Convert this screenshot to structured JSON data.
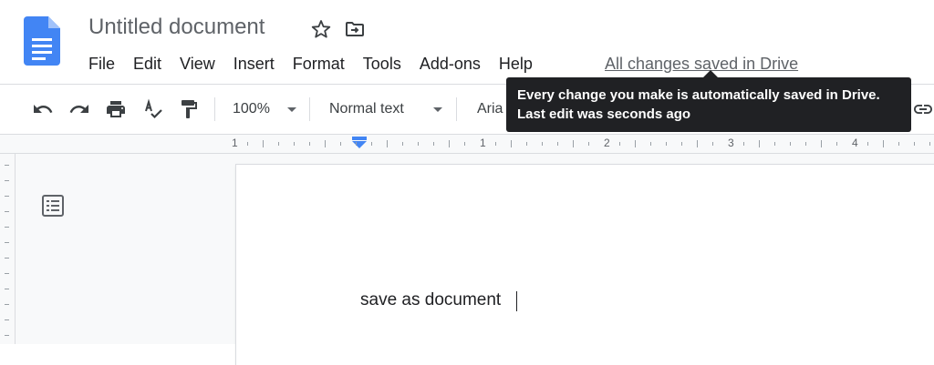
{
  "app": {
    "title": "Untitled document",
    "logo_icon": "google-docs-icon",
    "colors": {
      "brand_blue": "#4285f4",
      "tooltip_bg": "#202124",
      "ruler_marker": "#4285f4"
    }
  },
  "header": {
    "star_icon": "star-outline-icon",
    "move_icon": "move-to-folder-icon"
  },
  "menu": {
    "items": [
      "File",
      "Edit",
      "View",
      "Insert",
      "Format",
      "Tools",
      "Add-ons",
      "Help"
    ]
  },
  "save_status": "All changes saved in Drive",
  "tooltip": {
    "line1": "Every change you make is automatically saved in Drive.",
    "line2": "Last edit was seconds ago"
  },
  "toolbar": {
    "undo_icon": "undo-icon",
    "redo_icon": "redo-icon",
    "print_icon": "print-icon",
    "spellcheck_icon": "spellcheck-icon",
    "paint_format_icon": "paint-format-icon",
    "zoom": "100%",
    "style": "Normal text",
    "font": "Aria",
    "link_icon": "link-icon"
  },
  "ruler": {
    "labels": [
      "1",
      "1",
      "2",
      "3",
      "4"
    ]
  },
  "sidebar": {
    "outline_icon": "document-outline-icon"
  },
  "document": {
    "body_text": "save as document"
  }
}
